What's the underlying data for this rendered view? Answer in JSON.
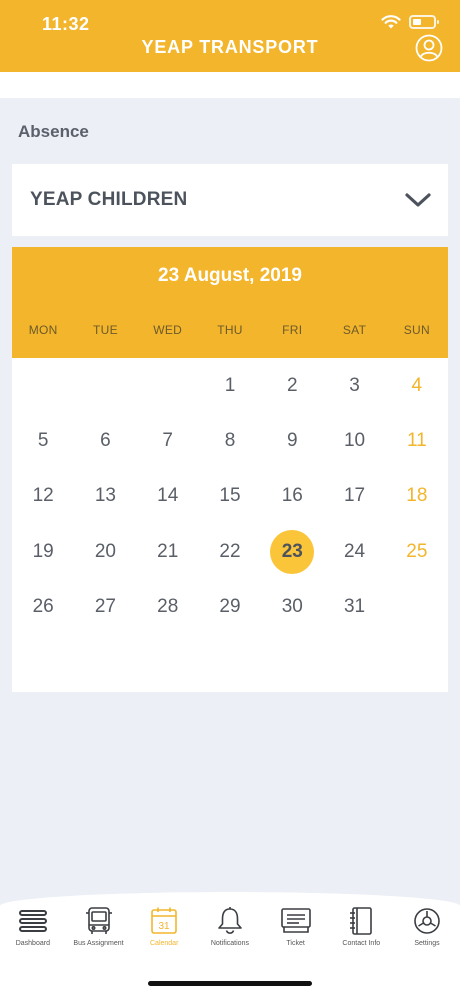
{
  "status": {
    "time": "11:32"
  },
  "header": {
    "title": "YEAP TRANSPORT"
  },
  "section": {
    "title": "Absence"
  },
  "selector": {
    "value": "YEAP CHILDREN"
  },
  "calendar": {
    "selected_date_label": "23 August, 2019",
    "weekdays": [
      "MON",
      "TUE",
      "WED",
      "THU",
      "FRI",
      "SAT",
      "SUN"
    ],
    "leading_blanks": 3,
    "days": [
      "1",
      "2",
      "3",
      "4",
      "5",
      "6",
      "7",
      "8",
      "9",
      "10",
      "11",
      "12",
      "13",
      "14",
      "15",
      "16",
      "17",
      "18",
      "19",
      "20",
      "21",
      "22",
      "23",
      "24",
      "25",
      "26",
      "27",
      "28",
      "29",
      "30",
      "31"
    ],
    "selected_day": "23",
    "weekend_color": "#f2b52c",
    "selected_color": "#fbc53a"
  },
  "tabbar": {
    "active_index": 2,
    "tabs": [
      {
        "label": "Dashboard",
        "icon": "menu-icon"
      },
      {
        "label": "Bus Assignment",
        "icon": "bus-icon"
      },
      {
        "label": "Calendar",
        "icon": "calendar-icon",
        "icon_text": "31"
      },
      {
        "label": "Notifications",
        "icon": "bell-icon"
      },
      {
        "label": "Ticket",
        "icon": "ticket-icon"
      },
      {
        "label": "Contact Info",
        "icon": "contact-book-icon"
      },
      {
        "label": "Settings",
        "icon": "gear-icon"
      }
    ]
  },
  "colors": {
    "accent": "#f2b52c",
    "background": "#eceff5"
  }
}
